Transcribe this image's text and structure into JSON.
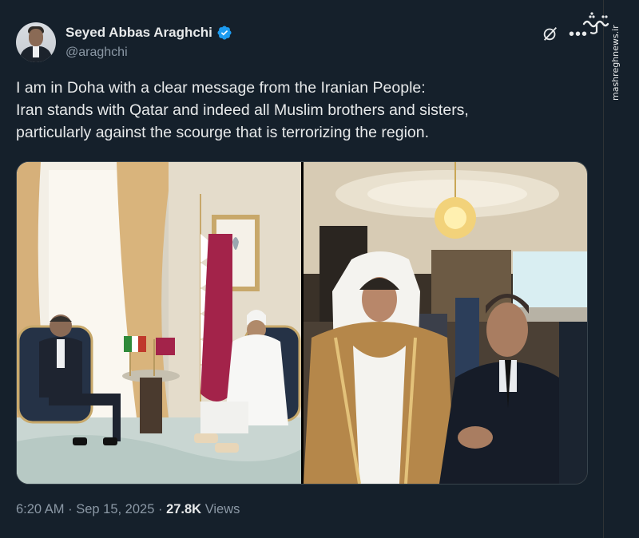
{
  "author": {
    "name": "Seyed Abbas Araghchi",
    "handle": "@araghchi",
    "verified": true,
    "avatar_icon": "profile-photo"
  },
  "tweet": {
    "lines": [
      "I am in Doha with a clear message from the Iranian People:",
      "Iran stands with Qatar and indeed all Muslim brothers and sisters,",
      "particularly against the scourge that is terrorizing the region."
    ]
  },
  "media": [
    {
      "icon": "photo-meeting-room"
    },
    {
      "icon": "photo-conference-hall"
    }
  ],
  "meta": {
    "time": "6:20 AM",
    "separator": " · ",
    "date": "Sep 15, 2025",
    "views_count": "27.8K",
    "views_label": "Views"
  },
  "watermark": {
    "logo_text": "مشرق",
    "url": "mashreghnews.ir"
  },
  "colors": {
    "background": "#15202b",
    "text": "#e7e9ea",
    "secondary": "#8b98a5",
    "verified": "#1d9bf0"
  }
}
